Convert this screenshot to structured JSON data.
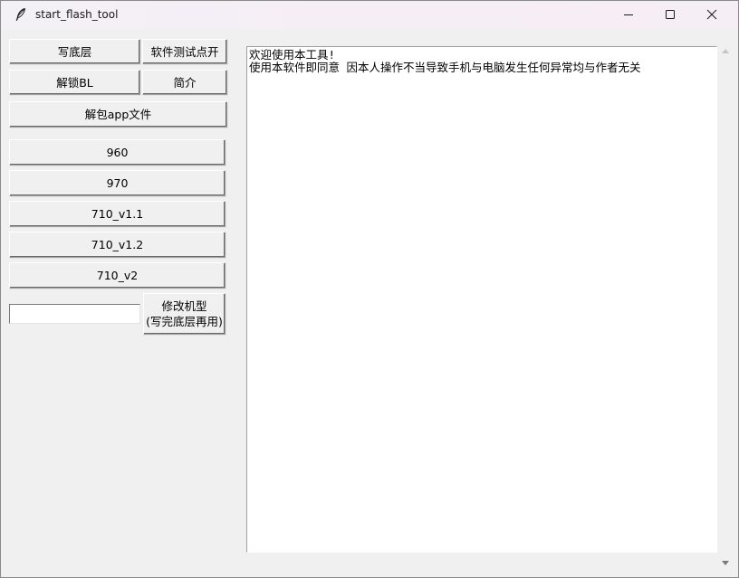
{
  "window": {
    "title": "start_flash_tool",
    "title_icon": "feather-icon"
  },
  "controls": {
    "minimize_icon": "minimize-icon",
    "maximize_icon": "maximize-icon",
    "close_icon": "close-icon"
  },
  "buttons": {
    "write_base": "写底层",
    "software_test": "软件测试点开",
    "unlock_bl": "解锁BL",
    "intro": "简介",
    "unpack_app": "解包app文件",
    "model_960": "960",
    "model_970": "970",
    "model_710_v11": "710_v1.1",
    "model_710_v12": "710_v1.2",
    "model_710_v2": "710_v2",
    "modify_model": "修改机型\n(写完底层再用)"
  },
  "model_entry": {
    "value": ""
  },
  "output": {
    "text": "欢迎使用本工具!\n使用本软件即同意 因本人操作不当导致手机与电脑发生任何异常均与作者无关"
  }
}
